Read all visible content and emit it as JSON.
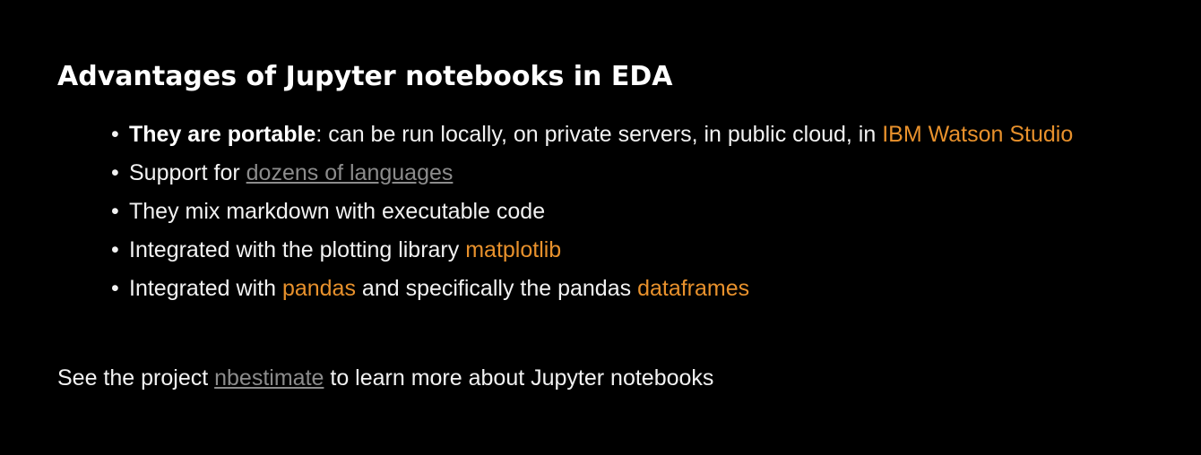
{
  "colors": {
    "background": "#000000",
    "text": "#f2f2f2",
    "accent_orange": "#e8912c",
    "link_gray": "#8c8c8c"
  },
  "slide": {
    "title": "Advantages of Jupyter notebooks in EDA",
    "bullet_glyph": "•",
    "bullets": [
      {
        "bold": "They are portable",
        "text": ": can be run locally, on private servers, in public cloud, in ",
        "link": "IBM Watson Studio"
      },
      {
        "text": "Support for ",
        "link": "dozens of languages"
      },
      {
        "text": "They mix markdown with executable code"
      },
      {
        "text": "Integrated with the plotting library ",
        "link": "matplotlib"
      },
      {
        "text": "Integrated with ",
        "link": "pandas",
        "text2": " and specifically the pandas ",
        "link2": "dataframes"
      }
    ],
    "footer": {
      "before": "See the project ",
      "link": "nbestimate",
      "after": " to learn more about Jupyter notebooks"
    }
  }
}
